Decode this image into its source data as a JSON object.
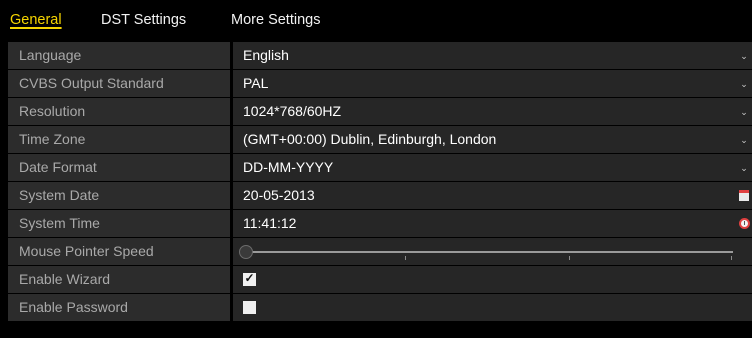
{
  "tabs": {
    "general": "General",
    "dst": "DST Settings",
    "more": "More Settings"
  },
  "settings": {
    "language": {
      "label": "Language",
      "value": "English"
    },
    "cvbs": {
      "label": "CVBS Output Standard",
      "value": "PAL"
    },
    "resolution": {
      "label": "Resolution",
      "value": "1024*768/60HZ"
    },
    "timezone": {
      "label": "Time Zone",
      "value": "(GMT+00:00) Dublin, Edinburgh, London"
    },
    "date_format": {
      "label": "Date Format",
      "value": "DD-MM-YYYY"
    },
    "system_date": {
      "label": "System Date",
      "value": "20-05-2013"
    },
    "system_time": {
      "label": "System Time",
      "value": "11:41:12"
    },
    "mouse_speed": {
      "label": "Mouse Pointer Speed",
      "level": 0
    },
    "enable_wizard": {
      "label": "Enable Wizard",
      "checked": true
    },
    "enable_password": {
      "label": "Enable Password",
      "checked": false
    }
  },
  "icons": {
    "dropdown": "chevron-down-icon",
    "date": "calendar-icon",
    "time": "clock-icon"
  },
  "colors": {
    "active_tab": "#f5d400",
    "label_bg": "#2c2c2c",
    "value_bg": "#262626"
  }
}
